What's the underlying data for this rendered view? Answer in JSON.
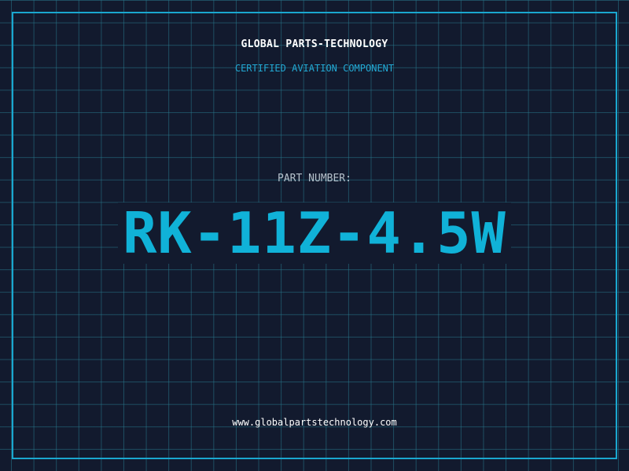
{
  "header": {
    "company": "GLOBAL PARTS-TECHNOLOGY",
    "subtitle": "CERTIFIED AVIATION COMPONENT"
  },
  "part": {
    "label": "PART NUMBER:",
    "number": "RK-11Z-4.5W"
  },
  "footer": {
    "website": "www.globalpartstechnology.com"
  },
  "colors": {
    "background": "#121a2e",
    "grid": "#28788c",
    "accent": "#1aa7cf",
    "part_number": "#10b2d8",
    "text_primary": "#ffffff",
    "text_muted": "#b6c2cc"
  }
}
